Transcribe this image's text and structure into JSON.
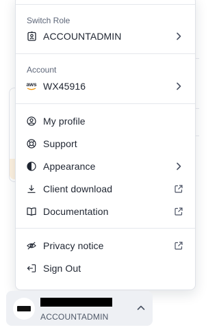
{
  "menu": {
    "switch_role": {
      "label": "Switch Role",
      "value": "ACCOUNTADMIN",
      "icon": "role-badge-icon"
    },
    "account": {
      "label": "Account",
      "value": "WX45916",
      "provider_logo": "aws"
    },
    "items": [
      {
        "label": "My profile",
        "icon": "user-circle-icon"
      },
      {
        "label": "Support",
        "icon": "lifebuoy-icon"
      },
      {
        "label": "Appearance",
        "icon": "half-circle-icon",
        "trailing": "chevron-right-icon"
      },
      {
        "label": "Client download",
        "icon": "download-icon",
        "trailing": "external-link-icon"
      },
      {
        "label": "Documentation",
        "icon": "book-icon",
        "trailing": "external-link-icon"
      }
    ],
    "footer_items": [
      {
        "label": "Privacy notice",
        "icon": "eye-off-icon",
        "trailing": "external-link-icon"
      },
      {
        "label": "Sign Out",
        "icon": "sign-out-icon"
      }
    ]
  },
  "user": {
    "role": "ACCOUNTADMIN",
    "name_redacted": true
  },
  "colors": {
    "text": "#1e2430",
    "muted": "#5d6678",
    "separator": "#e4e7ec",
    "user_chip_bg": "#eef0f4"
  }
}
